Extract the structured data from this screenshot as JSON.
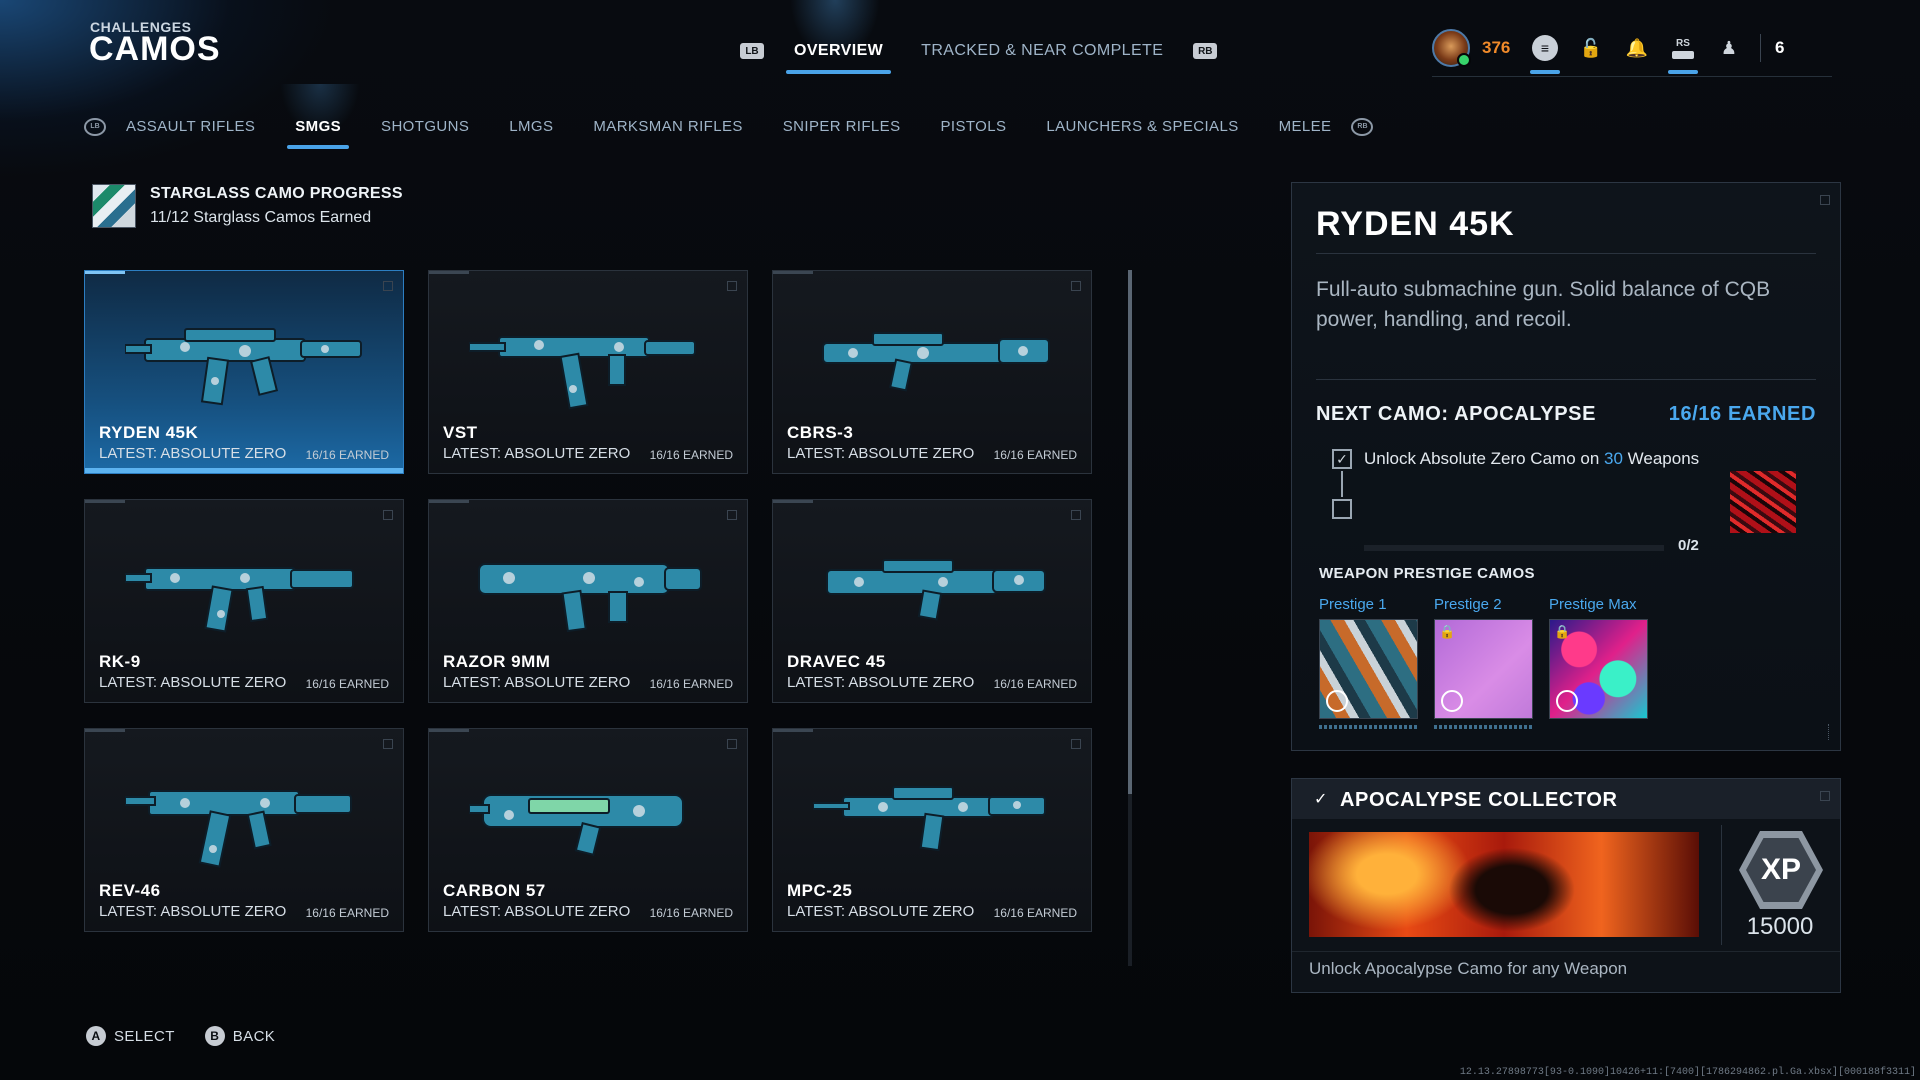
{
  "header": {
    "kicker": "CHALLENGES",
    "title": "CAMOS",
    "lb_glyph": "LB",
    "rb_glyph": "RB",
    "tabs": [
      {
        "label": "OVERVIEW",
        "active": true
      },
      {
        "label": "TRACKED & NEAR COMPLETE",
        "active": false
      }
    ],
    "player_level": "376",
    "rs_glyph": "RS",
    "party_count": "6"
  },
  "categories": {
    "bumper_left": "LB",
    "bumper_right": "RB",
    "items": [
      {
        "label": "ASSAULT RIFLES",
        "active": false
      },
      {
        "label": "SMGS",
        "active": true
      },
      {
        "label": "SHOTGUNS",
        "active": false
      },
      {
        "label": "LMGS",
        "active": false
      },
      {
        "label": "MARKSMAN RIFLES",
        "active": false
      },
      {
        "label": "SNIPER RIFLES",
        "active": false
      },
      {
        "label": "PISTOLS",
        "active": false
      },
      {
        "label": "LAUNCHERS & SPECIALS",
        "active": false
      },
      {
        "label": "MELEE",
        "active": false
      }
    ]
  },
  "progress": {
    "title": "STARGLASS CAMO PROGRESS",
    "subtitle": "11/12 Starglass Camos Earned"
  },
  "weapons": [
    {
      "name": "RYDEN 45K",
      "latest": "LATEST: ABSOLUTE ZERO",
      "earned": "16/16 EARNED",
      "selected": true
    },
    {
      "name": "VST",
      "latest": "LATEST: ABSOLUTE ZERO",
      "earned": "16/16 EARNED",
      "selected": false
    },
    {
      "name": "CBRS-3",
      "latest": "LATEST: ABSOLUTE ZERO",
      "earned": "16/16 EARNED",
      "selected": false
    },
    {
      "name": "RK-9",
      "latest": "LATEST: ABSOLUTE ZERO",
      "earned": "16/16 EARNED",
      "selected": false
    },
    {
      "name": "RAZOR 9MM",
      "latest": "LATEST: ABSOLUTE ZERO",
      "earned": "16/16 EARNED",
      "selected": false
    },
    {
      "name": "DRAVEC 45",
      "latest": "LATEST: ABSOLUTE ZERO",
      "earned": "16/16 EARNED",
      "selected": false
    },
    {
      "name": "REV-46",
      "latest": "LATEST: ABSOLUTE ZERO",
      "earned": "16/16 EARNED",
      "selected": false
    },
    {
      "name": "CARBON 57",
      "latest": "LATEST: ABSOLUTE ZERO",
      "earned": "16/16 EARNED",
      "selected": false
    },
    {
      "name": "MPC-25",
      "latest": "LATEST: ABSOLUTE ZERO",
      "earned": "16/16 EARNED",
      "selected": false
    }
  ],
  "detail": {
    "weapon_name": "RYDEN 45K",
    "description": "Full-auto submachine gun. Solid balance of CQB power, handling, and recoil.",
    "next_camo_label": "NEXT CAMO: APOCALYPSE",
    "next_camo_earned": "16/16 EARNED",
    "requirement": {
      "prefix": "Unlock Absolute Zero Camo on ",
      "highlight": "30",
      "suffix": " Weapons",
      "checked": true
    },
    "sub_progress": "0/2",
    "sub_progress_fraction": 0,
    "prestige_heading": "WEAPON PRESTIGE CAMOS",
    "prestige": [
      {
        "label": "Prestige 1",
        "locked": false
      },
      {
        "label": "Prestige 2",
        "locked": true
      },
      {
        "label": "Prestige Max",
        "locked": true
      }
    ]
  },
  "collector": {
    "title": "APOCALYPSE COLLECTOR",
    "xp_badge": "XP",
    "xp_amount": "15000",
    "description": "Unlock Apocalypse Camo for any Weapon"
  },
  "footer": {
    "select_glyph": "A",
    "select_label": "SELECT",
    "back_glyph": "B",
    "back_label": "BACK"
  },
  "build_id": "12.13.27898773[93-0.1090]10426+11:[7400][1786294862.pl.Ga.xbsx][000188f3311]",
  "colors": {
    "accent": "#4aa3e8",
    "level": "#f08a2a",
    "selected_card": "#1c6aa6"
  }
}
